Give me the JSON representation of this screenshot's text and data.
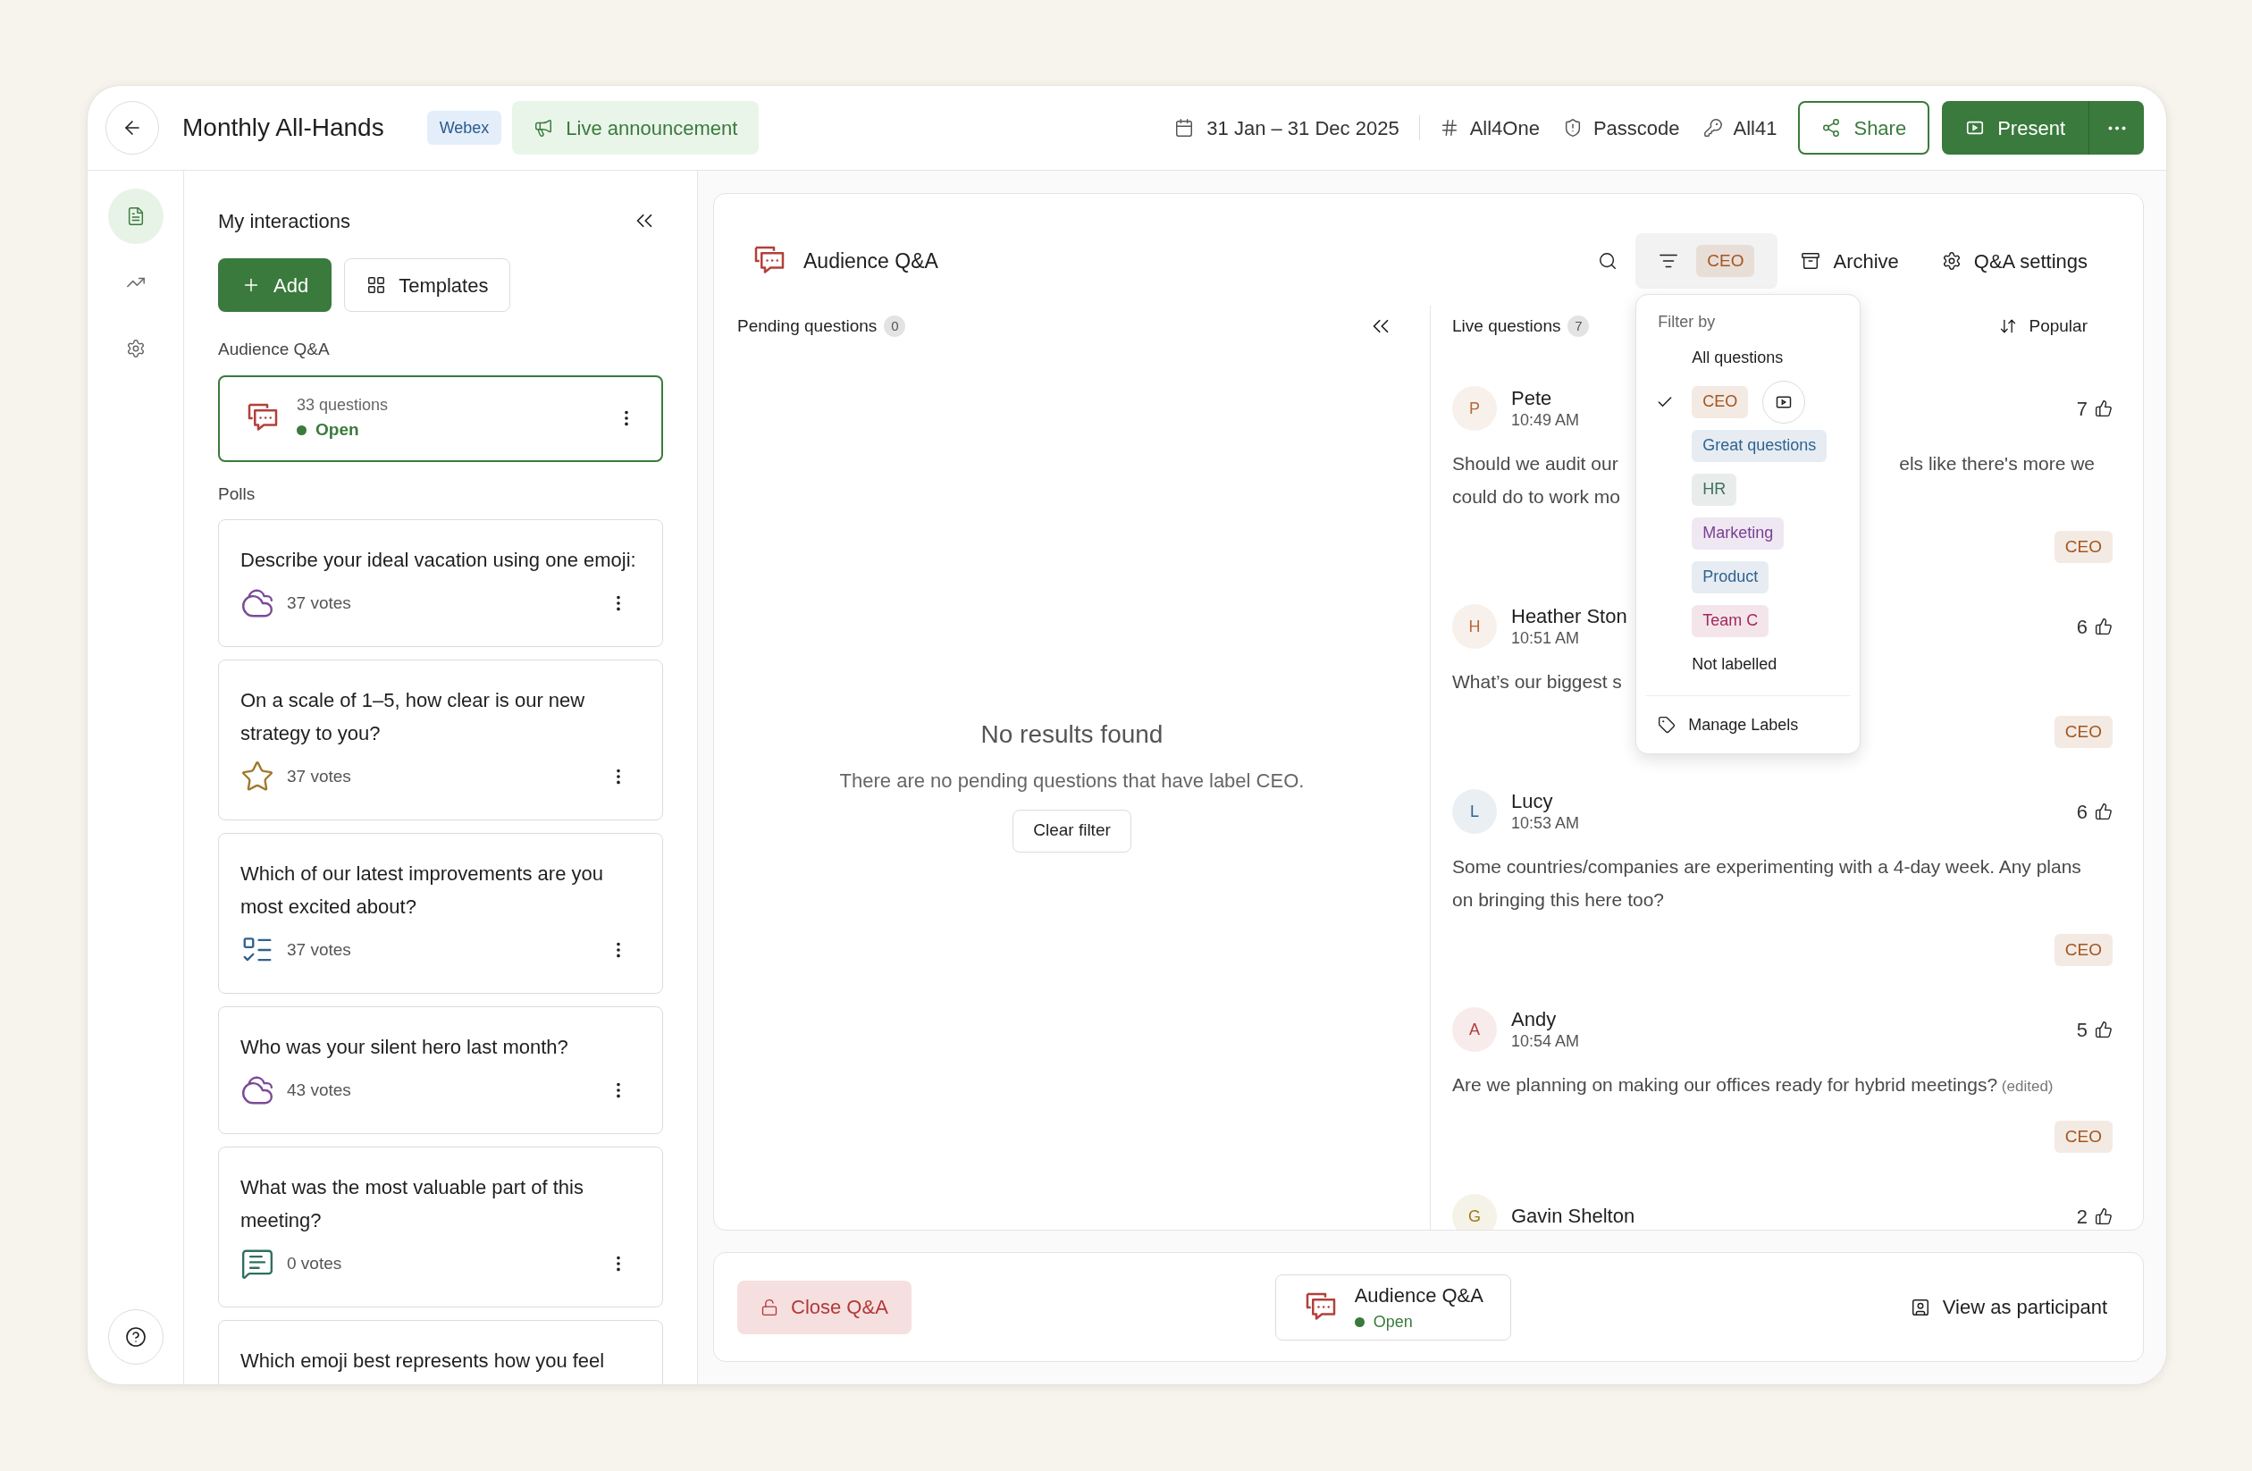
{
  "header": {
    "title": "Monthly All-Hands",
    "platform_badge": "Webex",
    "announcement": "Live announcement",
    "date_range": "31 Jan – 31 Dec 2025",
    "event_code": "All4One",
    "passcode_label": "Passcode",
    "passcode": "All41",
    "share": "Share",
    "present": "Present"
  },
  "rail": {
    "items": [
      {
        "kind": "interactions",
        "selected": true
      },
      {
        "kind": "analytics",
        "selected": false
      },
      {
        "kind": "settings",
        "selected": false
      }
    ]
  },
  "sidebar": {
    "title": "My interactions",
    "add": "Add",
    "templates": "Templates",
    "qa_section": "Audience Q&A",
    "qa_card": {
      "count": "33 questions",
      "status": "Open",
      "selected": true
    },
    "polls_section": "Polls",
    "polls": [
      {
        "kind": "word_cloud",
        "question": "Describe your ideal vacation using one emoji:",
        "votes": "37 votes"
      },
      {
        "kind": "rating",
        "question": "On a scale of 1–5, how clear is our new strategy to you?",
        "votes": "37 votes"
      },
      {
        "kind": "multiple_choice",
        "question": "Which of our latest improvements are you most excited about?",
        "votes": "37 votes"
      },
      {
        "kind": "word_cloud",
        "question": "Who was your silent hero last month?",
        "votes": "43 votes"
      },
      {
        "kind": "open_text",
        "question": "What was the most valuable part of this meeting?",
        "votes": "0 votes"
      },
      {
        "question": "Which emoji best represents how you feel"
      }
    ]
  },
  "qa": {
    "title": "Audience Q&A",
    "filter_label": {
      "text": "CEO",
      "color": "#a3561f"
    },
    "archive": "Archive",
    "settings": "Q&A settings",
    "pending": {
      "title": "Pending questions",
      "count": "0",
      "empty_title": "No results found",
      "empty_text": "There are no pending questions that have label CEO.",
      "clear_filter": "Clear filter"
    },
    "live": {
      "title": "Live questions",
      "count": "7",
      "sort": "Popular",
      "questions": [
        {
          "name": "Pete",
          "initial": "P",
          "color": "#b4693a",
          "time": "10:49 AM",
          "votes": "7",
          "lines": [
            [
              "Should we audit our",
              "els like there's more we"
            ],
            [
              "could do to work mo"
            ]
          ],
          "label": {
            "text": "CEO",
            "color": "#a3561f"
          }
        },
        {
          "name": "Heather Ston",
          "initial": "H",
          "color": "#b4693a",
          "time": "10:51 AM",
          "votes": "6",
          "lines": [
            [
              "What’s our biggest s"
            ]
          ],
          "label": {
            "text": "CEO",
            "color": "#a3561f"
          }
        },
        {
          "name": "Lucy",
          "initial": "L",
          "color": "#2f6391",
          "time": "10:53 AM",
          "votes": "6",
          "text": "Some countries/companies are experimenting with a 4-day week. Any plans on bringing this here too?",
          "label": {
            "text": "CEO",
            "color": "#a3561f"
          }
        },
        {
          "name": "Andy",
          "initial": "A",
          "color": "#b03a3a",
          "time": "10:54 AM",
          "votes": "5",
          "text": "Are we planning on making our offices ready for hybrid meetings?",
          "edited": "(edited)",
          "label": {
            "text": "CEO",
            "color": "#a3561f"
          }
        },
        {
          "name": "Gavin Shelton",
          "initial": "G",
          "color": "#9a7d1e",
          "votes": "2"
        }
      ]
    },
    "filter_menu": {
      "heading": "Filter by",
      "options": [
        {
          "kind": "plain",
          "text": "All questions",
          "selected": false
        },
        {
          "kind": "label",
          "text": "CEO",
          "color": "#a3561f",
          "selected": true
        },
        {
          "kind": "label",
          "text": "Great questions",
          "color": "#2f6391",
          "selected": false
        },
        {
          "kind": "label",
          "text": "HR",
          "color": "#3f6f5c",
          "selected": false
        },
        {
          "kind": "label",
          "text": "Marketing",
          "color": "#7b3f93",
          "selected": false
        },
        {
          "kind": "label",
          "text": "Product",
          "color": "#2f6391",
          "selected": false
        },
        {
          "kind": "label",
          "text": "Team C",
          "color": "#a3285c",
          "selected": false
        },
        {
          "kind": "plain",
          "text": "Not labelled",
          "selected": false
        }
      ],
      "manage": "Manage Labels"
    }
  },
  "bottom": {
    "close": "Close Q&A",
    "card_title": "Audience Q&A",
    "card_status": "Open",
    "view_as": "View as participant"
  }
}
